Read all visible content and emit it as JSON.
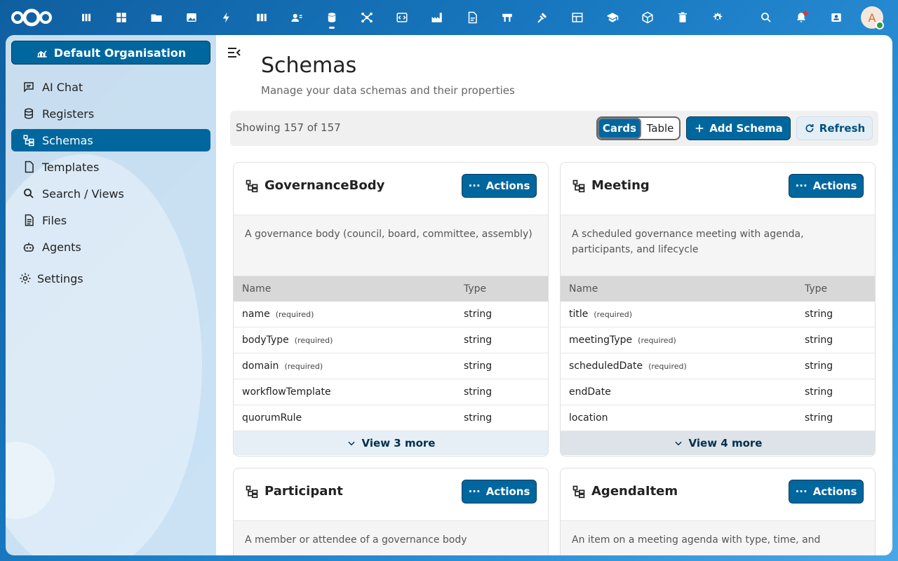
{
  "header": {
    "apps": [
      "dashboard-icon",
      "grid-icon",
      "folder-icon",
      "image-icon",
      "activity-icon",
      "deck-icon",
      "contacts-icon",
      "database-icon",
      "network-icon",
      "code-icon",
      "factory-icon",
      "document-icon",
      "board-icon",
      "gavel-icon",
      "table-icon",
      "school-icon",
      "cube-icon",
      "trash-icon",
      "settings-app-icon"
    ],
    "avatar_letter": "A"
  },
  "sidebar": {
    "org_label": "Default Organisation",
    "items": [
      {
        "label": "AI Chat",
        "icon": "chat-icon"
      },
      {
        "label": "Registers",
        "icon": "database-icon"
      },
      {
        "label": "Schemas",
        "icon": "schema-icon",
        "active": true
      },
      {
        "label": "Templates",
        "icon": "template-icon"
      },
      {
        "label": "Search / Views",
        "icon": "search-icon"
      },
      {
        "label": "Files",
        "icon": "files-icon"
      },
      {
        "label": "Agents",
        "icon": "robot-icon"
      }
    ],
    "settings_label": "Settings"
  },
  "main": {
    "title": "Schemas",
    "subtitle": "Manage your data schemas and their properties",
    "showing": "Showing 157 of 157",
    "toggle_cards": "Cards",
    "toggle_table": "Table",
    "add_label": "Add Schema",
    "refresh_label": "Refresh",
    "col_name": "Name",
    "col_type": "Type",
    "actions_label": "Actions",
    "required_label": "(required)",
    "cards": [
      {
        "title": "GovernanceBody",
        "description": "A governance body (council, board, committee, assembly)",
        "properties": [
          {
            "name": "name",
            "required": true,
            "type": "string"
          },
          {
            "name": "bodyType",
            "required": true,
            "type": "string"
          },
          {
            "name": "domain",
            "required": true,
            "type": "string"
          },
          {
            "name": "workflowTemplate",
            "required": false,
            "type": "string"
          },
          {
            "name": "quorumRule",
            "required": false,
            "type": "string"
          }
        ],
        "more": "View 3 more"
      },
      {
        "title": "Meeting",
        "description": "A scheduled governance meeting with agenda, participants, and lifecycle",
        "properties": [
          {
            "name": "title",
            "required": true,
            "type": "string"
          },
          {
            "name": "meetingType",
            "required": true,
            "type": "string"
          },
          {
            "name": "scheduledDate",
            "required": true,
            "type": "string"
          },
          {
            "name": "endDate",
            "required": false,
            "type": "string"
          },
          {
            "name": "location",
            "required": false,
            "type": "string"
          }
        ],
        "more": "View 4 more"
      },
      {
        "title": "Participant",
        "description": "A member or attendee of a governance body"
      },
      {
        "title": "AgendaItem",
        "description": "An item on a meeting agenda with type, time, and"
      }
    ]
  },
  "colors": {
    "primary": "#00679e",
    "border": "#003a5c"
  }
}
